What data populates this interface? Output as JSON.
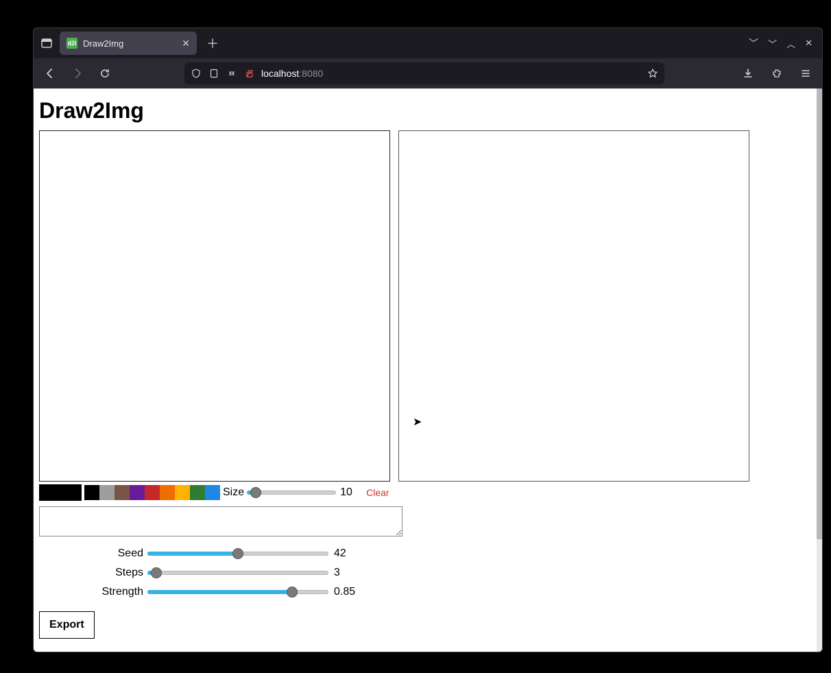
{
  "browser": {
    "tab_title": "Draw2Img",
    "favicon_text": "d2i",
    "url_host": "localhost",
    "url_port": ":8080"
  },
  "app": {
    "title": "Draw2Img"
  },
  "toolbar": {
    "size_label": "Size",
    "size_value": "10",
    "size_fill_pct": 10,
    "clear_label": "Clear",
    "current_color": "#000000",
    "swatches": [
      "#000000",
      "#9e9e9e",
      "#795548",
      "#6a1b9a",
      "#c62828",
      "#ef6c00",
      "#ffb300",
      "#2e7d32",
      "#1e88e5"
    ]
  },
  "prompt": {
    "value": ""
  },
  "params": {
    "seed": {
      "label": "Seed",
      "value": "42",
      "fill_pct": 50
    },
    "steps": {
      "label": "Steps",
      "value": "3",
      "fill_pct": 5
    },
    "strength": {
      "label": "Strength",
      "value": "0.85",
      "fill_pct": 80
    }
  },
  "buttons": {
    "export": "Export"
  }
}
